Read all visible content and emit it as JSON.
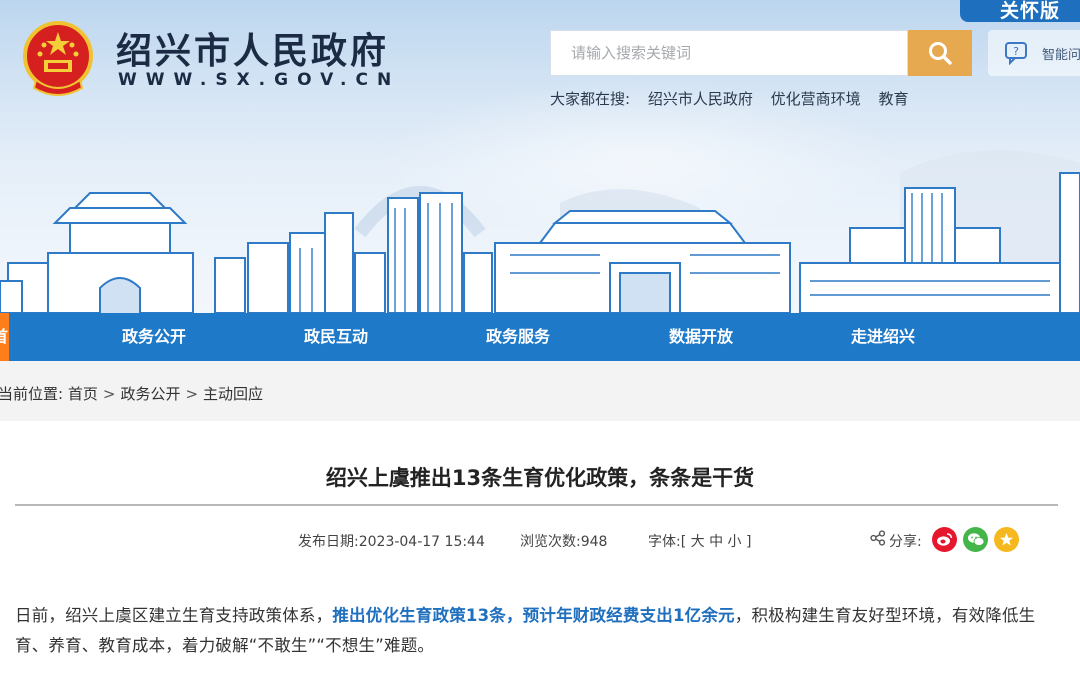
{
  "header": {
    "site_name": "绍兴市人民政府",
    "site_url": "WWW.SX.GOV.CN",
    "care_mode_label": "关怀版",
    "search_placeholder": "请输入搜索关键词",
    "robot_label": "智能问",
    "hot_search_label": "大家都在搜:",
    "hot_words": [
      "绍兴市人民政府",
      "优化营商环境",
      "教育"
    ]
  },
  "nav": {
    "home_label": "首页",
    "items": [
      "政务公开",
      "政民互动",
      "政务服务",
      "数据开放",
      "走进绍兴"
    ]
  },
  "breadcrumb": {
    "prefix": "当前位置:",
    "items": [
      "首页",
      "政务公开",
      "主动回应"
    ],
    "separator": ">"
  },
  "article": {
    "title": "绍兴上虞推出13条生育优化政策，条条是干货",
    "publish_label": "发布日期:",
    "publish_date": "2023-04-17 15:44",
    "views_label": "浏览次数:",
    "views": "948",
    "font_label": "字体:[",
    "font_large": "大",
    "font_medium": "中",
    "font_small": "小",
    "font_close": "]",
    "share_label": "分享:",
    "share_icons": [
      "weibo-icon",
      "wechat-icon",
      "qzone-icon"
    ],
    "paragraph_start": "日前，绍兴上虞区建立生育支持政策体系，",
    "paragraph_highlight": "推出优化生育政策13条，预计年财政经费支出1亿余元",
    "paragraph_end": "，积极构建生育友好型环境，有效降低生育、养育、教育成本，着力破解“不敢生”“不想生”难题。"
  },
  "colors": {
    "nav_blue": "#1f79c9",
    "home_orange": "#ff7d1a",
    "search_button": "#e6a94f",
    "highlight_text": "#1f6fbf",
    "weibo": "#e6162d",
    "wechat": "#44b549",
    "qzone": "#f5b81e"
  }
}
